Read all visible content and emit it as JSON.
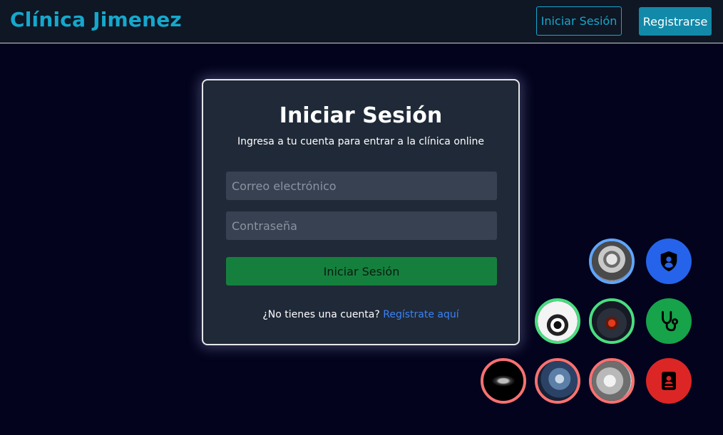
{
  "header": {
    "brand": "Clínica Jimenez",
    "login_label": "Iniciar Sesión",
    "register_label": "Registrarse"
  },
  "login_card": {
    "title": "Iniciar Sesión",
    "subtitle": "Ingresa a tu cuenta para entrar a la clínica online",
    "email_placeholder": "Correo electrónico",
    "password_placeholder": "Contraseña",
    "submit_label": "Iniciar Sesión",
    "no_account_text": "¿No tienes una cuenta?",
    "register_link": "Regístrate aquí"
  },
  "quick_access": {
    "roles": [
      {
        "name": "admin",
        "icon": "shield-user-icon",
        "color": "#2563eb"
      },
      {
        "name": "doctor",
        "icon": "stethoscope-icon",
        "color": "#16a34a"
      },
      {
        "name": "patient",
        "icon": "id-card-icon",
        "color": "#dc2626"
      }
    ],
    "ring_colors": {
      "admin": "#60a5fa",
      "doctor": "#4ade80",
      "patient": "#f87171"
    }
  }
}
